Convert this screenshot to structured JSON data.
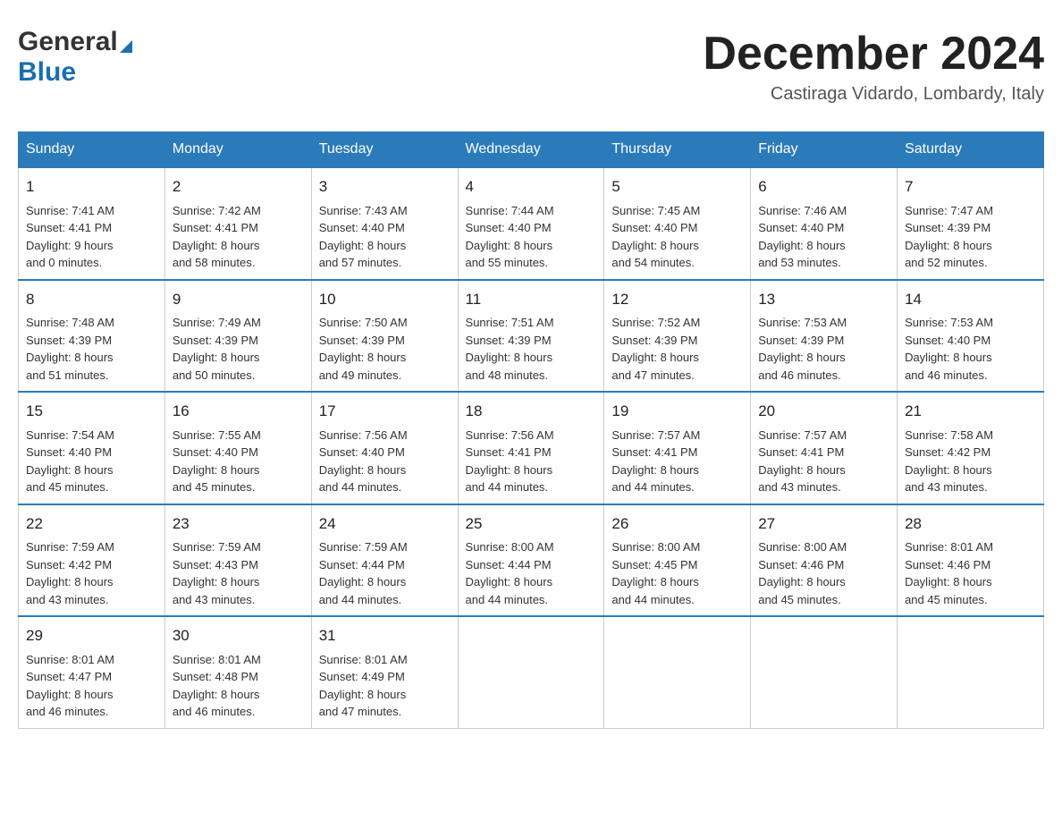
{
  "header": {
    "logo_general": "General",
    "logo_blue": "Blue",
    "month_title": "December 2024",
    "location": "Castiraga Vidardo, Lombardy, Italy"
  },
  "days_of_week": [
    "Sunday",
    "Monday",
    "Tuesday",
    "Wednesday",
    "Thursday",
    "Friday",
    "Saturday"
  ],
  "weeks": [
    [
      {
        "day": "1",
        "sunrise": "7:41 AM",
        "sunset": "4:41 PM",
        "daylight": "9 hours and 0 minutes."
      },
      {
        "day": "2",
        "sunrise": "7:42 AM",
        "sunset": "4:41 PM",
        "daylight": "8 hours and 58 minutes."
      },
      {
        "day": "3",
        "sunrise": "7:43 AM",
        "sunset": "4:40 PM",
        "daylight": "8 hours and 57 minutes."
      },
      {
        "day": "4",
        "sunrise": "7:44 AM",
        "sunset": "4:40 PM",
        "daylight": "8 hours and 55 minutes."
      },
      {
        "day": "5",
        "sunrise": "7:45 AM",
        "sunset": "4:40 PM",
        "daylight": "8 hours and 54 minutes."
      },
      {
        "day": "6",
        "sunrise": "7:46 AM",
        "sunset": "4:40 PM",
        "daylight": "8 hours and 53 minutes."
      },
      {
        "day": "7",
        "sunrise": "7:47 AM",
        "sunset": "4:39 PM",
        "daylight": "8 hours and 52 minutes."
      }
    ],
    [
      {
        "day": "8",
        "sunrise": "7:48 AM",
        "sunset": "4:39 PM",
        "daylight": "8 hours and 51 minutes."
      },
      {
        "day": "9",
        "sunrise": "7:49 AM",
        "sunset": "4:39 PM",
        "daylight": "8 hours and 50 minutes."
      },
      {
        "day": "10",
        "sunrise": "7:50 AM",
        "sunset": "4:39 PM",
        "daylight": "8 hours and 49 minutes."
      },
      {
        "day": "11",
        "sunrise": "7:51 AM",
        "sunset": "4:39 PM",
        "daylight": "8 hours and 48 minutes."
      },
      {
        "day": "12",
        "sunrise": "7:52 AM",
        "sunset": "4:39 PM",
        "daylight": "8 hours and 47 minutes."
      },
      {
        "day": "13",
        "sunrise": "7:53 AM",
        "sunset": "4:39 PM",
        "daylight": "8 hours and 46 minutes."
      },
      {
        "day": "14",
        "sunrise": "7:53 AM",
        "sunset": "4:40 PM",
        "daylight": "8 hours and 46 minutes."
      }
    ],
    [
      {
        "day": "15",
        "sunrise": "7:54 AM",
        "sunset": "4:40 PM",
        "daylight": "8 hours and 45 minutes."
      },
      {
        "day": "16",
        "sunrise": "7:55 AM",
        "sunset": "4:40 PM",
        "daylight": "8 hours and 45 minutes."
      },
      {
        "day": "17",
        "sunrise": "7:56 AM",
        "sunset": "4:40 PM",
        "daylight": "8 hours and 44 minutes."
      },
      {
        "day": "18",
        "sunrise": "7:56 AM",
        "sunset": "4:41 PM",
        "daylight": "8 hours and 44 minutes."
      },
      {
        "day": "19",
        "sunrise": "7:57 AM",
        "sunset": "4:41 PM",
        "daylight": "8 hours and 44 minutes."
      },
      {
        "day": "20",
        "sunrise": "7:57 AM",
        "sunset": "4:41 PM",
        "daylight": "8 hours and 43 minutes."
      },
      {
        "day": "21",
        "sunrise": "7:58 AM",
        "sunset": "4:42 PM",
        "daylight": "8 hours and 43 minutes."
      }
    ],
    [
      {
        "day": "22",
        "sunrise": "7:59 AM",
        "sunset": "4:42 PM",
        "daylight": "8 hours and 43 minutes."
      },
      {
        "day": "23",
        "sunrise": "7:59 AM",
        "sunset": "4:43 PM",
        "daylight": "8 hours and 43 minutes."
      },
      {
        "day": "24",
        "sunrise": "7:59 AM",
        "sunset": "4:44 PM",
        "daylight": "8 hours and 44 minutes."
      },
      {
        "day": "25",
        "sunrise": "8:00 AM",
        "sunset": "4:44 PM",
        "daylight": "8 hours and 44 minutes."
      },
      {
        "day": "26",
        "sunrise": "8:00 AM",
        "sunset": "4:45 PM",
        "daylight": "8 hours and 44 minutes."
      },
      {
        "day": "27",
        "sunrise": "8:00 AM",
        "sunset": "4:46 PM",
        "daylight": "8 hours and 45 minutes."
      },
      {
        "day": "28",
        "sunrise": "8:01 AM",
        "sunset": "4:46 PM",
        "daylight": "8 hours and 45 minutes."
      }
    ],
    [
      {
        "day": "29",
        "sunrise": "8:01 AM",
        "sunset": "4:47 PM",
        "daylight": "8 hours and 46 minutes."
      },
      {
        "day": "30",
        "sunrise": "8:01 AM",
        "sunset": "4:48 PM",
        "daylight": "8 hours and 46 minutes."
      },
      {
        "day": "31",
        "sunrise": "8:01 AM",
        "sunset": "4:49 PM",
        "daylight": "8 hours and 47 minutes."
      },
      null,
      null,
      null,
      null
    ]
  ]
}
